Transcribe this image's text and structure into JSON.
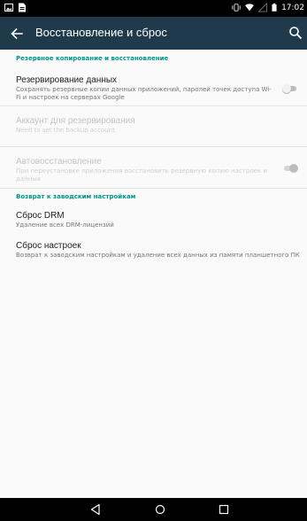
{
  "status_bar": {
    "time": "17:02"
  },
  "app_bar": {
    "title": "Восстановление и сброс"
  },
  "sections": {
    "backup": {
      "header": "Резервное копирование и восстановление",
      "items": [
        {
          "title": "Резервирование данных",
          "summary": "Сохранять резервные копии данных приложений, паролей точек доступа Wi-Fi и настроек на серверах Google",
          "enabled": true,
          "toggle": "off"
        },
        {
          "title": "Аккаунт для резервирования",
          "summary": "Need to set the backup account",
          "enabled": false
        },
        {
          "title": "Автовосстановление",
          "summary": "При переустановке приложения восстановить резервную копию настроек и данных",
          "enabled": false,
          "toggle": "on"
        }
      ]
    },
    "factory": {
      "header": "Возврат к заводским настройкам",
      "items": [
        {
          "title": "Сброс DRM",
          "summary": "Удаление всех DRM-лицензий"
        },
        {
          "title": "Сброс настроек",
          "summary": "Возврат к заводским настройкам и удаление всех данных из памяти планшетного ПК"
        }
      ]
    }
  },
  "icons": {
    "status_left": [
      "image-icon",
      "file-icon"
    ],
    "status_right": [
      "vibrate-icon",
      "wifi-icon",
      "signal-icon",
      "battery-icon"
    ],
    "app_bar": [
      "back-arrow-icon",
      "search-icon"
    ],
    "nav": [
      "nav-back-icon",
      "nav-home-icon",
      "nav-recents-icon"
    ]
  },
  "colors": {
    "app_bar": "#1f3a4b",
    "accent": "#009688",
    "background": "#fafafa"
  }
}
